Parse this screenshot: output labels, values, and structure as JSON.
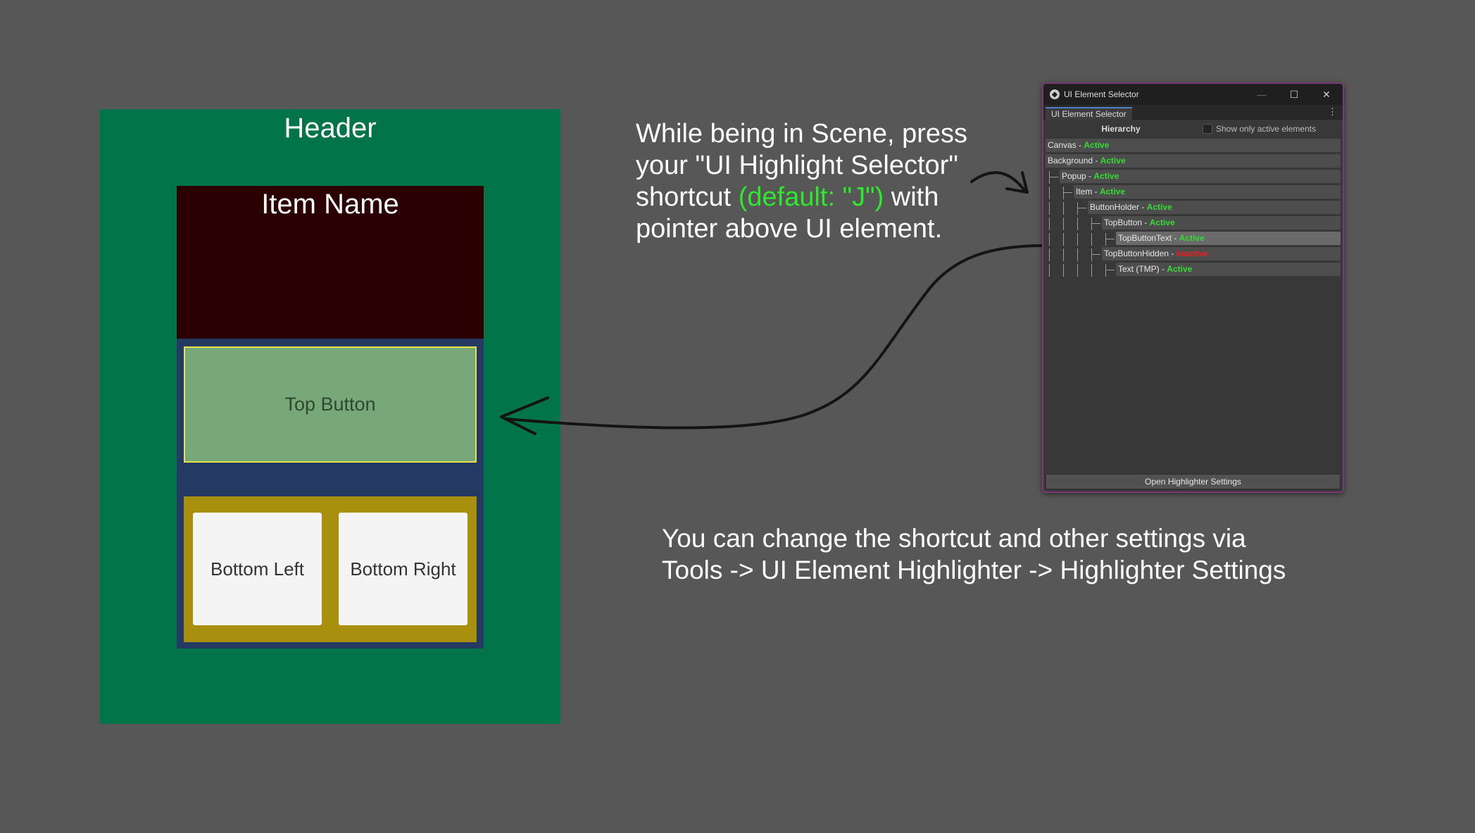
{
  "scene": {
    "header": "Header",
    "item_name": "Item Name",
    "top_button": "Top Button",
    "bottom_left": "Bottom Left",
    "bottom_right": "Bottom Right"
  },
  "instructions": {
    "part1": "While being in Scene, press your \"UI Highlight Selector\" shortcut ",
    "shortcut": "(default: \"J\")",
    "part2": " with pointer above UI element.",
    "settings_line1": "You can change the shortcut and other settings via",
    "settings_line2": "Tools -> UI Element Highlighter -> Highlighter Settings"
  },
  "window": {
    "title": "UI Element Selector",
    "tab": "UI Element Selector",
    "menu_glyph": "⋮",
    "minimize_glyph": "—",
    "maximize_glyph": "☐",
    "close_glyph": "✕",
    "hierarchy_label": "Hierarchy",
    "show_only_active_label": "Show only active elements",
    "open_settings_button": "Open Highlighter Settings",
    "hierarchy": [
      {
        "name": "Canvas",
        "sep": " - ",
        "status": "Active"
      },
      {
        "name": "Background",
        "sep": " - ",
        "status": "Active"
      },
      {
        "name": "Popup",
        "sep": " - ",
        "status": "Active"
      },
      {
        "name": "Item",
        "sep": " - ",
        "status": "Active"
      },
      {
        "name": "ButtonHolder",
        "sep": " - ",
        "status": "Active"
      },
      {
        "name": "TopButton",
        "sep": " - ",
        "status": "Active"
      },
      {
        "name": "TopButtonText",
        "sep": " - ",
        "status": "Active"
      },
      {
        "name": "TopButtonHidden",
        "sep": " - ",
        "status": "Inactive"
      },
      {
        "name": "Text (TMP)",
        "sep": " - ",
        "status": "Active"
      }
    ]
  },
  "colors": {
    "active": "#33dd33",
    "inactive": "#ee1c1c",
    "shortcut_highlight": "#2ee82e",
    "panel_green": "#02744a",
    "item_box": "#2a0002",
    "button_green": "#78a77a",
    "gold": "#a8900e"
  }
}
